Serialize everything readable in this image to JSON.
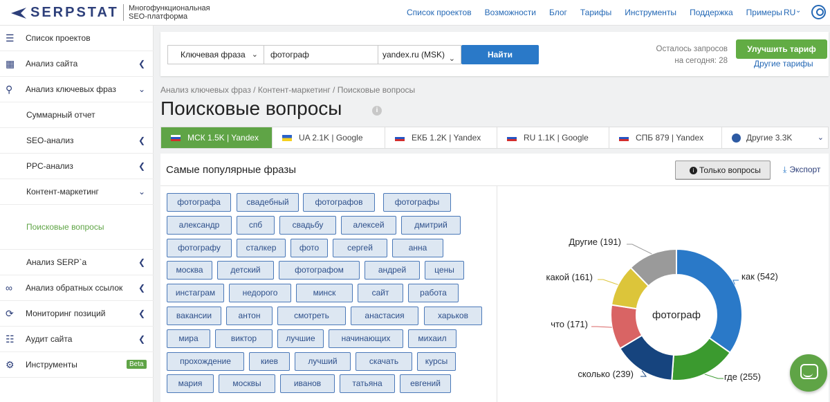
{
  "header": {
    "brand": "SERPSTAT",
    "tagline_line1": "Многофункциональная",
    "tagline_line2": "SEO-платформа",
    "nav": [
      "Список проектов",
      "Возможности",
      "Блог",
      "Тарифы",
      "Инструменты",
      "Поддержка",
      "Примеры"
    ],
    "lang": "RU"
  },
  "sidebar": {
    "items": [
      {
        "label": "Список проектов",
        "icon": "menu-icon"
      },
      {
        "label": "Анализ сайта",
        "icon": "analysis-icon"
      },
      {
        "label": "Анализ ключевых фраз",
        "icon": "key-icon"
      },
      {
        "label": "Суммарный отчет"
      },
      {
        "label": "SEO-анализ"
      },
      {
        "label": "PPC-анализ"
      },
      {
        "label": "Контент-маркетинг"
      },
      {
        "label": "Поисковые вопросы"
      },
      {
        "label": "Анализ SERP`а"
      },
      {
        "label": "Анализ обратных ссылок",
        "icon": "link-icon"
      },
      {
        "label": "Мониторинг позиций",
        "icon": "history-icon"
      },
      {
        "label": "Аудит сайта",
        "icon": "sitemap-icon"
      },
      {
        "label": "Инструменты",
        "icon": "gear-icon"
      }
    ],
    "beta": "Beta"
  },
  "search": {
    "type": "Ключевая фраза",
    "keyword": "фотограф",
    "engine": "yandex.ru (MSK)",
    "find": "Найти",
    "remain_line1": "Осталось запросов",
    "remain_line2": "на сегодня: 28",
    "upgrade": "Улучшить тариф",
    "other": "Другие тарифы"
  },
  "breadcrumb": "Анализ ключевых фраз / Контент-маркетинг / Поисковые вопросы",
  "title": "Поисковые вопросы",
  "tabs": [
    {
      "label": "МСК 1.5K | Yandex",
      "flag": "ru",
      "active": true
    },
    {
      "label": "UA 2.1K | Google",
      "flag": "ua"
    },
    {
      "label": "ЕКБ 1.2K | Yandex",
      "flag": "ru"
    },
    {
      "label": "RU 1.1K | Google",
      "flag": "ru"
    },
    {
      "label": "СПБ 879 | Yandex",
      "flag": "ru"
    },
    {
      "label": "Другие 3.3K",
      "flag": "globe"
    }
  ],
  "panel": {
    "heading": "Самые популярные фразы",
    "only_questions": "Только вопросы",
    "export": "Экспорт"
  },
  "chips": [
    [
      "фотографа",
      "свадебный",
      "фотографов",
      "фотографы"
    ],
    [
      "александр",
      "спб",
      "свадьбу",
      "алексей",
      "дмитрий"
    ],
    [
      "фотографу",
      "сталкер",
      "фото",
      "сергей",
      "анна"
    ],
    [
      "москва",
      "детский",
      "фотографом",
      "андрей",
      "цены"
    ],
    [
      "инстаграм",
      "недорого",
      "минск",
      "сайт",
      "работа"
    ],
    [
      "вакансии",
      "антон",
      "смотреть",
      "анастасия",
      "харьков"
    ],
    [
      "мира",
      "виктор",
      "лучшие",
      "начинающих",
      "михаил"
    ],
    [
      "прохождение",
      "киев",
      "лучший",
      "скачать",
      "курсы"
    ],
    [
      "мария",
      "москвы",
      "иванов",
      "татьяна",
      "евгений"
    ]
  ],
  "chart_data": {
    "type": "pie",
    "center_label": "фотограф",
    "slices": [
      {
        "label": "как (542)",
        "value": 542,
        "color": "#2a79c8"
      },
      {
        "label": "где (255)",
        "value": 255,
        "color": "#3b9a2f"
      },
      {
        "label": "сколько (239)",
        "value": 239,
        "color": "#16447e"
      },
      {
        "label": "что (171)",
        "value": 171,
        "color": "#d96464"
      },
      {
        "label": "какой (161)",
        "value": 161,
        "color": "#dcc53a"
      },
      {
        "label": "Другие (191)",
        "value": 191,
        "color": "#9a9a9a"
      }
    ]
  }
}
